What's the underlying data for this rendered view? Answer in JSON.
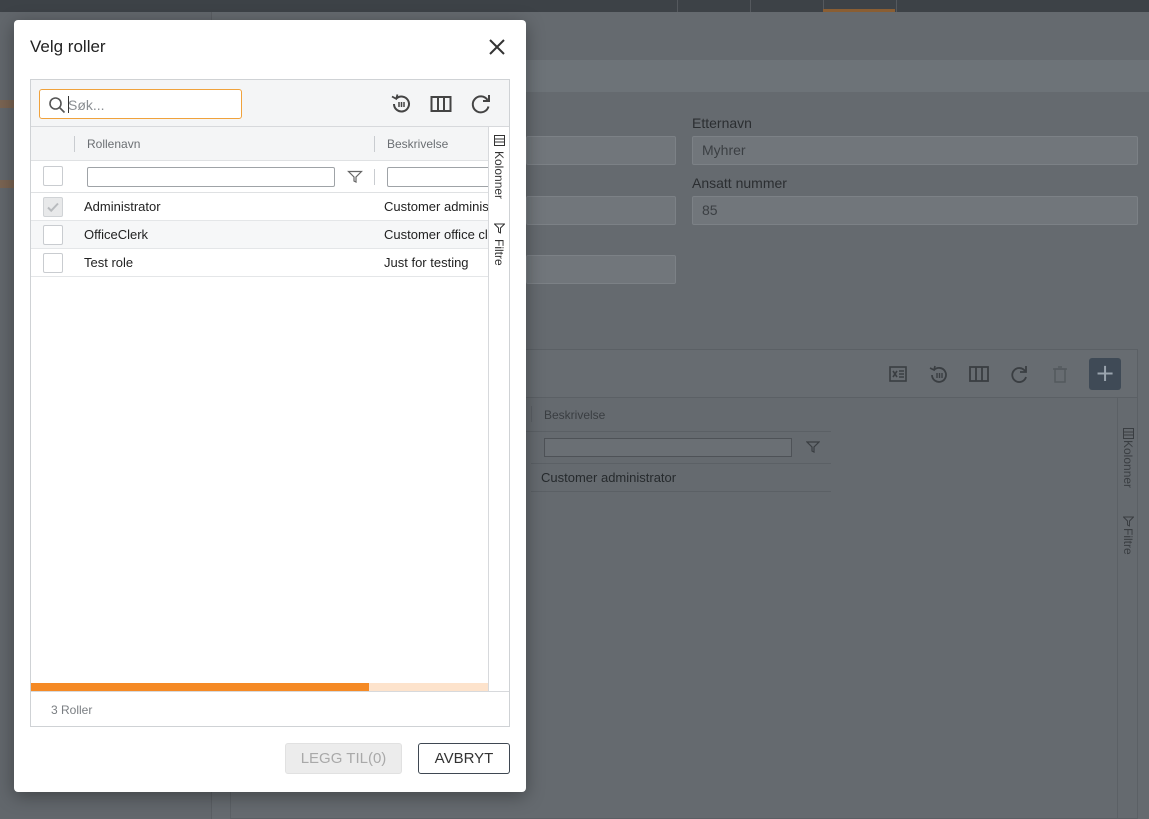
{
  "dialog": {
    "title": "Velg roller",
    "search": {
      "placeholder": "Søk...",
      "value": ""
    },
    "toolbar": {
      "icons": [
        "restore-layout-icon",
        "columns-icon",
        "refresh-icon"
      ]
    },
    "columns": [
      "Rollenavn",
      "Beskrivelse"
    ],
    "rows": [
      {
        "name": "Administrator",
        "description": "Customer adminis",
        "checked": true
      },
      {
        "name": "OfficeClerk",
        "description": "Customer office cl",
        "checked": false
      },
      {
        "name": "Test role",
        "description": "Just for testing",
        "checked": false
      }
    ],
    "side_tabs": {
      "columns": "Kolonner",
      "filters": "Filtre"
    },
    "scroll_progress": 0.74,
    "count_label": "3 Roller",
    "buttons": {
      "add": "LEGG TIL(0)",
      "cancel": "AVBRYT"
    }
  },
  "background": {
    "fields": [
      {
        "label": "Etternavn",
        "value": "Myhrer"
      },
      {
        "label": "Ansatt nummer",
        "value": "85"
      }
    ],
    "grid": {
      "column": "Beskrivelse",
      "cell": "Customer administrator",
      "side_tabs": {
        "columns": "Kolonner",
        "filters": "Filtre"
      },
      "toolbar_icons": [
        "excel-export-icon",
        "restore-layout-icon",
        "columns-icon",
        "refresh-icon",
        "delete-icon",
        "add-icon"
      ]
    }
  },
  "colors": {
    "accent": "#f58a25",
    "search_border": "#f0a23c",
    "overlay": "#656a6f"
  }
}
